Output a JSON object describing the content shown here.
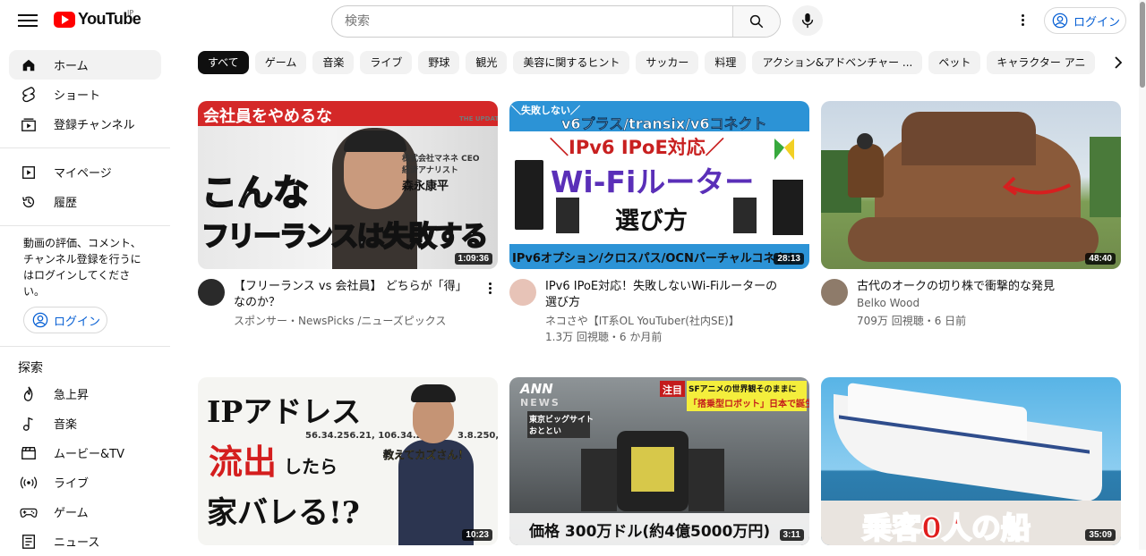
{
  "header": {
    "logo_text": "YouTube",
    "logo_region": "JP",
    "search_placeholder": "検索",
    "login_label": "ログイン"
  },
  "sidebar": {
    "main_items": [
      {
        "label": "ホーム",
        "icon": "home-icon"
      },
      {
        "label": "ショート",
        "icon": "shorts-icon"
      },
      {
        "label": "登録チャンネル",
        "icon": "subscriptions-icon"
      }
    ],
    "you_items": [
      {
        "label": "マイページ",
        "icon": "my-page-icon"
      },
      {
        "label": "履歴",
        "icon": "history-icon"
      }
    ],
    "signin_note": "動画の評価、コメント、チャンネル登録を行うにはログインしてください。",
    "login_label": "ログイン",
    "explore_heading": "探索",
    "explore_items": [
      {
        "label": "急上昇",
        "icon": "trending-icon"
      },
      {
        "label": "音楽",
        "icon": "music-icon"
      },
      {
        "label": "ムービー&TV",
        "icon": "movie-icon"
      },
      {
        "label": "ライブ",
        "icon": "live-icon"
      },
      {
        "label": "ゲーム",
        "icon": "gaming-icon"
      },
      {
        "label": "ニュース",
        "icon": "news-icon"
      }
    ]
  },
  "chips": [
    "すべて",
    "ゲーム",
    "音楽",
    "ライブ",
    "野球",
    "観光",
    "美容に関するヒント",
    "サッカー",
    "料理",
    "アクション&アドベンチャー ...",
    "ペット",
    "キャラクター アニ"
  ],
  "videos": [
    {
      "title": "【フリーランス vs 会社員】 どちらが「得」なのか？",
      "channel": "スポンサー・NewsPicks /ニューズピックス",
      "stats": "",
      "duration": "1:09:36",
      "thumb_text": [
        "会社員をやめるな",
        "こんな",
        "フリーランスは失敗する",
        "株式会社マネネ CEO",
        "経済アナリスト",
        "森永康平",
        "THE UPDATE"
      ]
    },
    {
      "title": "IPv6 IPoE対応！失敗しないWi-Fiルーターの選び方",
      "channel": "ネコさや【IT系OL YouTuber(社内SE)】",
      "stats": "1.3万 回視聴・6 か月前",
      "duration": "28:13",
      "thumb_text": [
        "＼失敗しない／",
        "v6プラス/transix/v6コネクト",
        "＼IPv6 IPoE対応／",
        "Wi-Fiルーター",
        "選び方",
        "IPv6オプション/クロスパス/OCNバーチャルコネクト"
      ]
    },
    {
      "title": "古代のオークの切り株で衝撃的な発見",
      "channel": "Belko Wood",
      "stats": "709万 回視聴・6 日前",
      "duration": "48:40",
      "thumb_text": []
    },
    {
      "title": "",
      "channel": "",
      "stats": "",
      "duration": "10:23",
      "thumb_text": [
        "IPアドレス",
        "流出",
        "したら",
        "家バレる!?",
        "教えてカズさん！",
        "56.34.256.21, 106.34.25",
        "3.8.250, 1"
      ]
    },
    {
      "title": "",
      "channel": "",
      "stats": "",
      "duration": "3:11",
      "thumb_text": [
        "ANN",
        "NEWS",
        "東京ビッグサイト",
        "おととい",
        "注目",
        "SFアニメの世界観そのままに",
        "「搭乗型ロボット」日本で誕生",
        "価格 300万ドル(約4億5000万円)"
      ]
    },
    {
      "title": "",
      "channel": "",
      "stats": "",
      "duration": "35:09",
      "thumb_text": [
        "乗客0人の船"
      ]
    }
  ]
}
